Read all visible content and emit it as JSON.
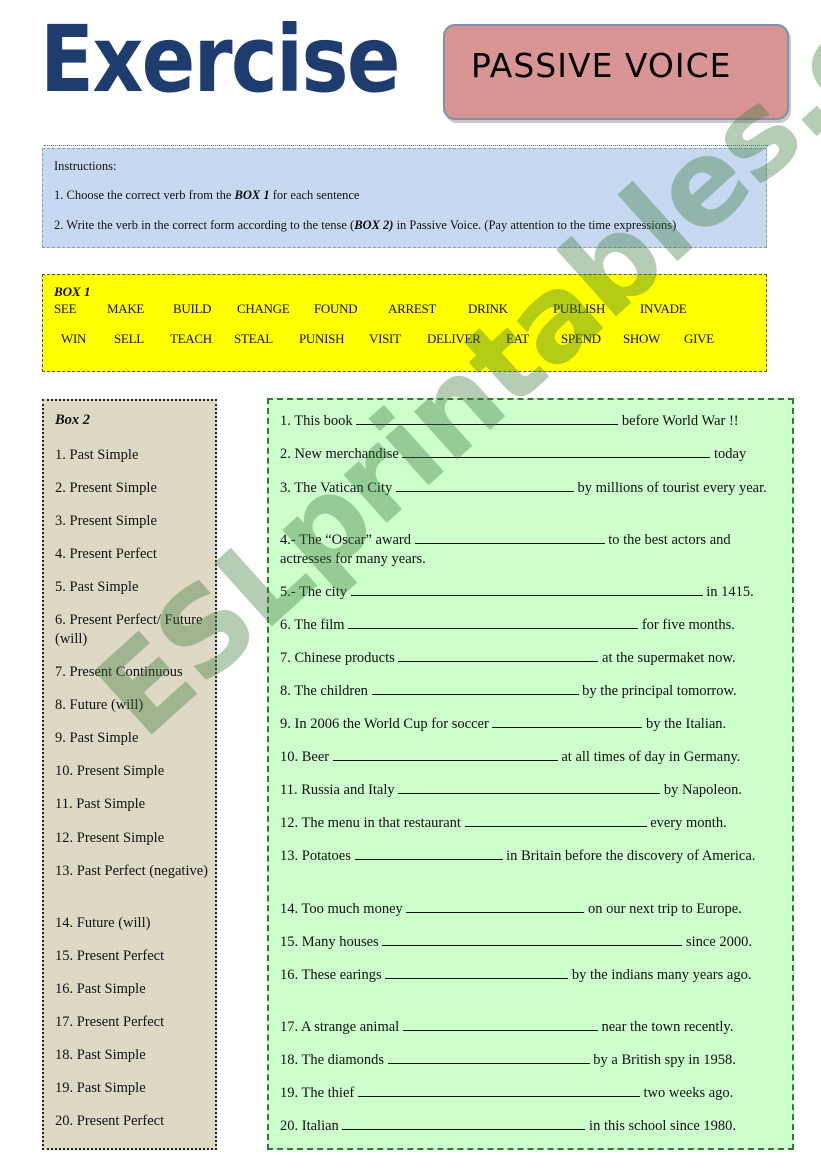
{
  "header": {
    "title": "Exercise",
    "badge": "PASSIVE VOICE"
  },
  "instructions": {
    "heading": "Instructions:",
    "line1_pre": "1. Choose the correct verb from the ",
    "line1_bold": "BOX 1",
    "line1_post": " for each sentence",
    "line2_pre": "2. Write the verb in the correct form according to the tense (",
    "line2_bold": "BOX 2)",
    "line2_post": " in Passive Voice. (Pay attention to the time expressions)"
  },
  "box1": {
    "label": "BOX 1",
    "row1": [
      "SEE",
      "MAKE",
      "BUILD",
      "CHANGE",
      "FOUND",
      "ARREST",
      "DRINK",
      "PUBLISH",
      "INVADE"
    ],
    "row2": [
      "WIN",
      "SELL",
      "TEACH",
      "STEAL",
      "PUNISH",
      "VISIT",
      "DELIVER",
      "EAT",
      "SPEND",
      "SHOW",
      "GIVE"
    ]
  },
  "box2": {
    "label": "Box 2",
    "tenses": [
      "1. Past Simple",
      "2. Present Simple",
      "3. Present Simple",
      "4. Present Perfect",
      "5. Past Simple",
      "6. Present Perfect/ Future (will)",
      "7. Present Continuous",
      "8. Future (will)",
      "9. Past Simple",
      "10. Present Simple",
      "11. Past Simple",
      "12. Present Simple",
      "13. Past Perfect (negative)",
      "14. Future (will)",
      "15. Present Perfect",
      "16. Past Simple",
      "17. Present Perfect",
      "18. Past Simple",
      "19. Past Simple",
      "20. Present Perfect"
    ]
  },
  "exercises": [
    {
      "before": "1. This book ",
      "after": " before World War !!"
    },
    {
      "before": "2. New merchandise ",
      "after": " today"
    },
    {
      "before": "3. The Vatican City ",
      "after": " by millions of tourist every year."
    },
    {
      "before": "4.- The “Oscar” award ",
      "after": " to the best actors and actresses for many years."
    },
    {
      "before": "5.- The city ",
      "after": " in 1415."
    },
    {
      "before": "6. The film ",
      "after": " for five months."
    },
    {
      "before": "7. Chinese products ",
      "after": " at the supermaket now."
    },
    {
      "before": "8. The children ",
      "after": " by the principal tomorrow."
    },
    {
      "before": "9. In 2006 the World Cup for soccer ",
      "after": " by the Italian."
    },
    {
      "before": "10. Beer ",
      "after": " at all times of day in Germany."
    },
    {
      "before": "11. Russia and Italy ",
      "after": " by Napoleon."
    },
    {
      "before": "12. The menu in that restaurant ",
      "after": " every month."
    },
    {
      "before": "13. Potatoes ",
      "after": " in Britain before the discovery of America."
    },
    {
      "before": "14. Too much money ",
      "after": " on our next trip to Europe."
    },
    {
      "before": "15. Many houses ",
      "after": " since 2000."
    },
    {
      "before": "16. These earings ",
      "after": " by the indians many years ago."
    },
    {
      "before": "17. A strange animal ",
      "after": " near the town recently."
    },
    {
      "before": "18. The diamonds ",
      "after": " by a British spy in 1958."
    },
    {
      "before": "19. The thief ",
      "after": " two weeks ago."
    },
    {
      "before": "20. Italian ",
      "after": " in this school since 1980."
    }
  ],
  "watermark": "ESLprintables.com",
  "colors": {
    "title": "#1f3c6e",
    "badge": "#d99594",
    "instructions_bg": "#c6d9f1",
    "box1_bg": "#ffff00",
    "box2_bg": "#ddd9c4",
    "exercises_bg": "#ccffcc"
  }
}
